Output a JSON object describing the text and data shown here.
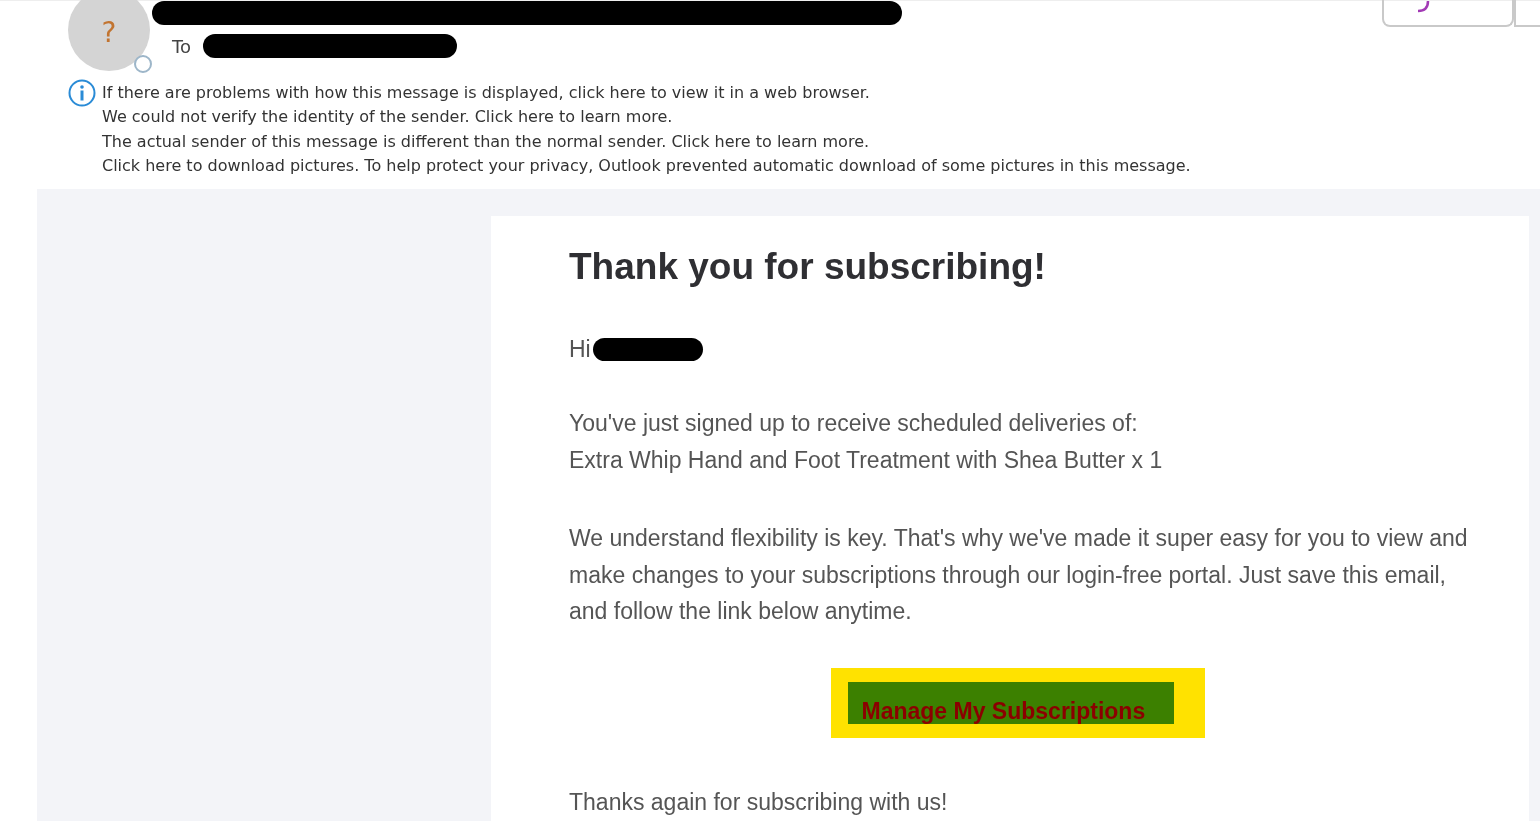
{
  "header": {
    "avatar_glyph": "?",
    "to_label": "To"
  },
  "notices": [
    "If there are problems with how this message is displayed, click here to view it in a web browser.",
    "We could not verify the identity of the sender. Click here to learn more.",
    "The actual sender of this message is different than the normal sender. Click here to learn more.",
    "Click here to download pictures. To help protect your privacy, Outlook prevented automatic download of some pictures in this message."
  ],
  "email": {
    "heading": "Thank you for subscribing!",
    "greeting": "Hi",
    "paragraphs": [
      [
        "You've just signed up to receive scheduled deliveries of:",
        "Extra Whip Hand and Foot Treatment with Shea Butter x 1"
      ],
      [
        "We understand flexibility is key. That's why we've made it super easy for you to view and make changes to your subscriptions through our login-free portal. Just save this email, and follow the link below anytime."
      ]
    ],
    "button": "Manage My Subscriptions",
    "closing": "Thanks again for subscribing with us!"
  }
}
